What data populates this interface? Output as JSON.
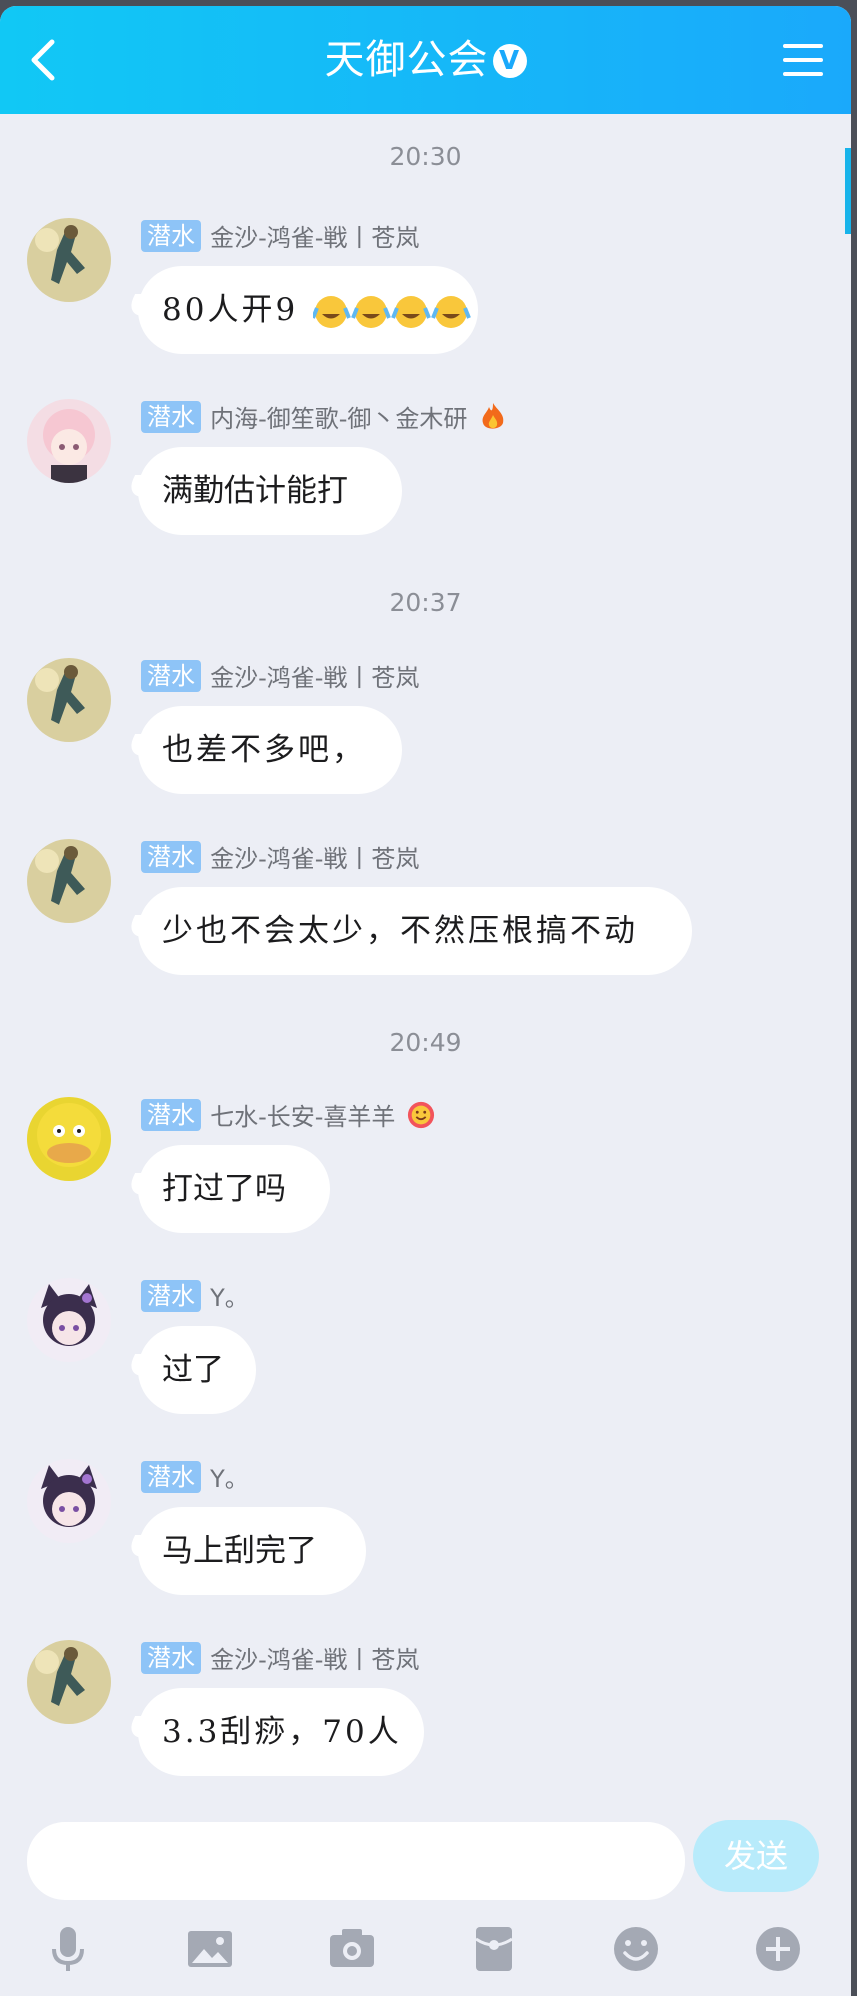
{
  "header": {
    "title": "天御公会",
    "verified_badge": "V",
    "colors": {
      "start": "#11c8f5",
      "end": "#1aa9fb"
    }
  },
  "timestamps": [
    "20:30",
    "20:37",
    "20:49"
  ],
  "messages": [
    {
      "tag": "潜水",
      "sender": "金沙-鸿雀-戦丨苍岚",
      "text": "80人开9",
      "reaction_emojis": "crying-laughing-emoji x4",
      "avatar": "figure-avatar"
    },
    {
      "tag": "潜水",
      "sender": "内海-御笙歌-御丶金木研",
      "sender_icon": "fire-icon",
      "text": "满勤估计能打",
      "avatar": "pink-anime-girl-avatar"
    },
    {
      "tag": "潜水",
      "sender": "金沙-鸿雀-戦丨苍岚",
      "text": "也差不多吧，",
      "avatar": "figure-avatar"
    },
    {
      "tag": "潜水",
      "sender": "金沙-鸿雀-戦丨苍岚",
      "text": "少也不会太少，不然压根搞不动",
      "avatar": "figure-avatar"
    },
    {
      "tag": "潜水",
      "sender": "七水-长安-喜羊羊",
      "sender_icon": "flower-smile-icon",
      "text": "打过了吗",
      "avatar": "yellow-duck-avatar"
    },
    {
      "tag": "潜水",
      "sender": "Y。",
      "text": "过了",
      "avatar": "purple-cat-girl-avatar"
    },
    {
      "tag": "潜水",
      "sender": "Y。",
      "text": "马上刮完了",
      "avatar": "purple-cat-girl-avatar"
    },
    {
      "tag": "潜水",
      "sender": "金沙-鸿雀-戦丨苍岚",
      "text": "3.3刮痧，70人",
      "avatar": "figure-avatar"
    }
  ],
  "composer": {
    "input_value": "",
    "send_label": "发送"
  },
  "toolbar": [
    "microphone-icon",
    "image-icon",
    "camera-icon",
    "red-packet-icon",
    "emoji-icon",
    "plus-icon"
  ]
}
